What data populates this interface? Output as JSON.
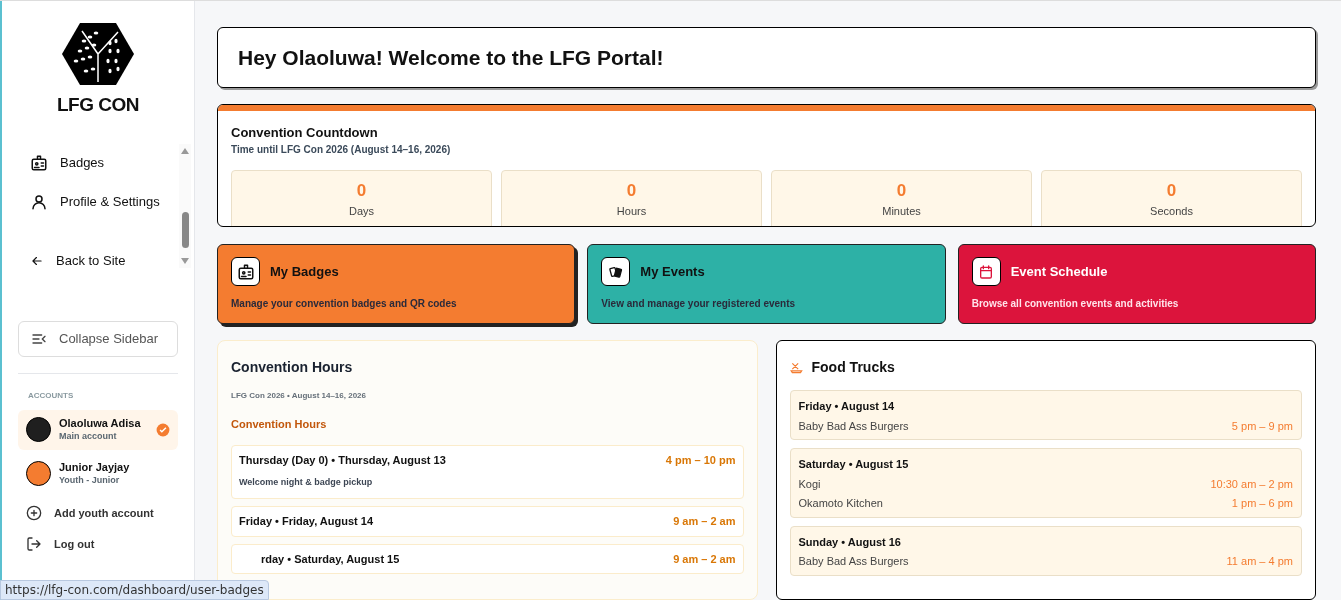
{
  "sidebar": {
    "logo_text": "LFG CON",
    "nav": [
      {
        "label": "Badges",
        "kind": "badge"
      },
      {
        "label": "Profile & Settings",
        "kind": "user"
      },
      {
        "label": "Back to Site",
        "kind": "back"
      }
    ],
    "collapse_button": "Collapse Sidebar",
    "accounts_heading": "ACCOUNTS",
    "accounts": [
      {
        "name": "Olaoluwa Adisa",
        "role": "Main account",
        "selected": true,
        "color": "#1f1f1f"
      },
      {
        "name": "Junior Jayjay",
        "role": "Youth - Junior",
        "selected": false,
        "color": "#f47c30"
      }
    ],
    "actions": [
      {
        "label": "Add youth account",
        "kind": "add"
      },
      {
        "label": "Log out",
        "kind": "logout"
      }
    ]
  },
  "welcome": "Hey Olaoluwa! Welcome to the LFG Portal!",
  "countdown": {
    "title": "Convention Countdown",
    "subtitle": "Time until LFG Con 2026 (August 14–16, 2026)",
    "units": [
      {
        "value": "0",
        "label": "Days"
      },
      {
        "value": "0",
        "label": "Hours"
      },
      {
        "value": "0",
        "label": "Minutes"
      },
      {
        "value": "0",
        "label": "Seconds"
      }
    ]
  },
  "cards": [
    {
      "title": "My Badges",
      "description": "Manage your convention badges and QR codes",
      "color": "#f47c30",
      "kind": "badge",
      "selected": true
    },
    {
      "title": "My Events",
      "description": "View and manage your registered events",
      "color": "#2db1a6",
      "kind": "events",
      "selected": false
    },
    {
      "title": "Event Schedule",
      "description": "Browse all convention events and activities",
      "color": "#dc143c",
      "kind": "calendar",
      "selected": false
    }
  ],
  "hours": {
    "title": "Convention Hours",
    "subtitle": "LFG Con 2026 • August 14–16, 2026",
    "section": "Convention Hours",
    "days": [
      {
        "day": "Thursday (Day 0) • Thursday, August 13",
        "time": "4 pm – 10 pm",
        "note": "Welcome night & badge pickup"
      },
      {
        "day": "Friday • Friday, August 14",
        "time": "9 am – 2 am"
      },
      {
        "day": "rday • Saturday, August 15",
        "time": "9 am – 2 am"
      }
    ]
  },
  "food_trucks": {
    "title": "Food Trucks",
    "days": [
      {
        "day": "Friday • August 14",
        "trucks": [
          {
            "name": "Baby Bad Ass Burgers",
            "time": "5 pm – 9 pm"
          }
        ]
      },
      {
        "day": "Saturday • August 15",
        "trucks": [
          {
            "name": "Kogi",
            "time": "10:30 am – 2 pm"
          },
          {
            "name": "Okamoto Kitchen",
            "time": "1 pm – 6 pm"
          }
        ]
      },
      {
        "day": "Sunday • August 16",
        "trucks": [
          {
            "name": "Baby Bad Ass Burgers",
            "time": "11 am – 4 pm"
          }
        ]
      }
    ]
  },
  "status_url": "https://lfg-con.com/dashboard/user-badges"
}
